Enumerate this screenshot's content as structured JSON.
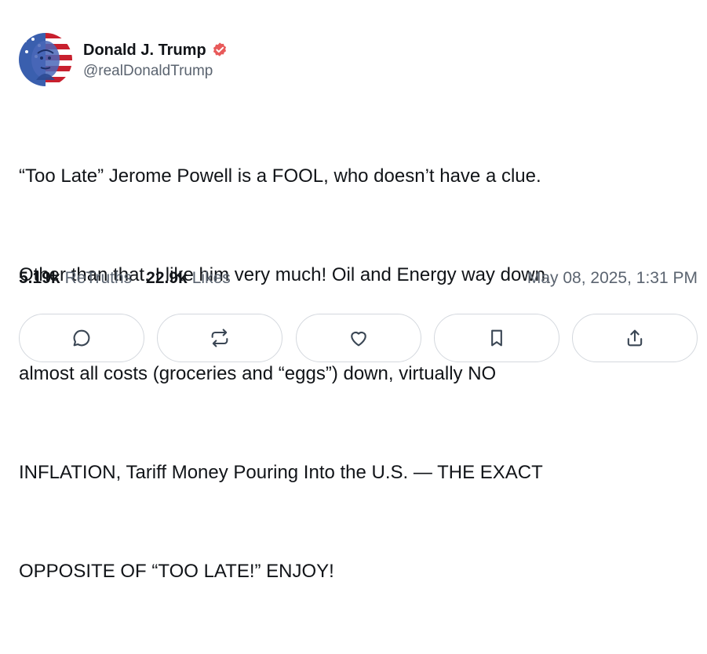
{
  "author": {
    "display_name": "Donald J. Trump",
    "handle": "@realDonaldTrump",
    "verified": true
  },
  "post": {
    "lines": [
      "“Too Late” Jerome Powell is a FOOL, who doesn’t have a clue.",
      "Other than that, I like him very much! Oil and Energy way down,",
      "almost all costs (groceries and “eggs”) down, virtually NO",
      "INFLATION, Tariff Money Pouring Into the U.S. — THE EXACT",
      "OPPOSITE OF “TOO LATE!” ENJOY!"
    ]
  },
  "stats": {
    "retruths_count": "5.19k",
    "retruths_label": "ReTruths",
    "likes_count": "22.9k",
    "likes_label": "Likes",
    "timestamp": "May 08, 2025, 1:31 PM"
  },
  "actions": [
    {
      "icon": "reply-icon"
    },
    {
      "icon": "retruth-icon"
    },
    {
      "icon": "like-icon"
    },
    {
      "icon": "bookmark-icon"
    },
    {
      "icon": "share-icon"
    }
  ],
  "colors": {
    "verified_badge": "#e85a5a",
    "muted_text": "#5b6470",
    "border": "#d4d8de",
    "icon": "#3a4654"
  }
}
